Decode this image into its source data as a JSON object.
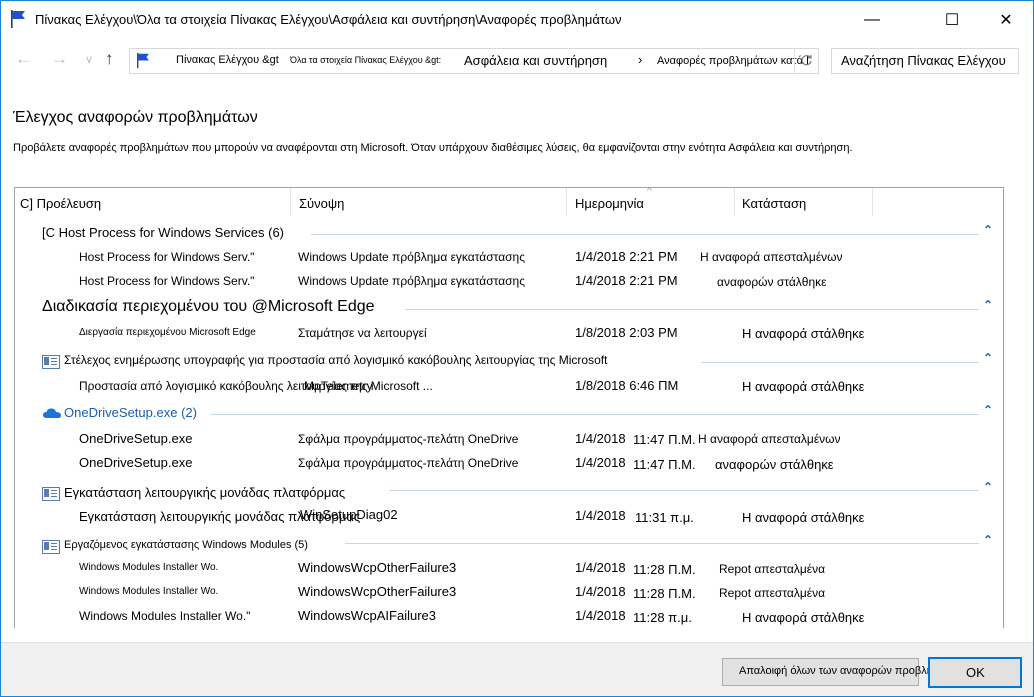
{
  "window": {
    "title": "Πίνακας Ελέγχου\\Όλα τα στοιχεία Πίνακας Ελέγχου\\Ασφάλεια και συντήρηση\\Αναφορές προβλημάτων",
    "minimize_glyph": "—",
    "maximize_glyph": "☐",
    "close_glyph": "✕",
    "icon": "flag-icon",
    "accent_color": "#1883d7"
  },
  "nav": {
    "back_glyph": "←",
    "forward_glyph": "→",
    "recent_glyph": "∨",
    "up_glyph": "↑",
    "breadcrumb": [
      "Πίνακας Ελέγχου &gt",
      "Όλα τα στοιχεία Πίνακας Ελέγχου &gt:",
      "Ασφάλεια και συντήρηση",
      "›",
      "Αναφορές προβλημάτων κατά Ι"
    ],
    "search_placeholder": "Αναζήτηση Πίνακας Ελέγχου"
  },
  "page": {
    "heading": "Έλεγχος αναφορών προβλημάτων",
    "description": "Προβάλετε αναφορές προβλημάτων που μπορούν να αναφέρονται στη Microsoft. Όταν υπάρχουν διαθέσιμες λύσεις, θα εμφανίζονται στην ενότητα Ασφάλεια και συντήρηση."
  },
  "columns": {
    "source": "C] Προέλευση",
    "summary": "Σύνοψη",
    "date": "Ημερομηνία",
    "status": "Κατάσταση",
    "sort_glyph": "^"
  },
  "groups": [
    {
      "title": "[C Host Process for Windows Services (6)",
      "rows": [
        {
          "source": "Host Process for Windows Serv.\"",
          "summary": "Windows Update πρόβλημα εγκατάστασης",
          "date": "1/4/2018 2:21 PM",
          "status": "Η αναφορά απεσταλμένων"
        },
        {
          "source": "Host Process for Windows Serv.\"",
          "summary": "Windows Update πρόβλημα εγκατάστασης",
          "date": "1/4/2018 2:21 PM",
          "status": "αναφορών στάλθηκε"
        }
      ]
    },
    {
      "title": "Διαδικασία περιεχομένου του @Microsoft Edge",
      "rows": [
        {
          "source": "Διεργασία περιεχομένου Microsoft Edge",
          "summary": "Σταμάτησε να λειτουργεί",
          "date": "1/8/2018 2:03 PM",
          "status": "Η αναφορά στάλθηκε"
        }
      ]
    },
    {
      "title": "Στέλεχος ενημέρωσης υπογραφής για προστασία από λογισμικό κακόβουλης λειτουργίας της Microsoft",
      "rows": [
        {
          "source": "Προστασία από λογισμικό κακόβουλης λειτουργίας της Microsoft ...",
          "summary": "MpTelemetry",
          "date": "1/8/2018 6:46 ΠΜ",
          "status": "Η αναφορά στάλθηκε"
        }
      ]
    },
    {
      "title": "OneDriveSetup.exe (2)",
      "rows": [
        {
          "source": "OneDriveSetup.exe",
          "summary": "Σφάλμα προγράμματος-πελάτη OneDrive",
          "date": "1/4/2018",
          "time": "11:47 Π.Μ.",
          "status": "Η αναφορά απεσταλμένων"
        },
        {
          "source": "OneDriveSetup.exe",
          "summary": "Σφάλμα προγράμματος-πελάτη OneDrive",
          "date": "1/4/2018",
          "time": "11:47 Π.Μ.",
          "status": "αναφορών στάλθηκε"
        }
      ]
    },
    {
      "title": "Εγκατάσταση λειτουργικής μονάδας πλατφόρμας",
      "rows": [
        {
          "source": "Εγκατάσταση λειτουργικής μονάδας πλατφόρμας",
          "summary": "WinSetupDiag02",
          "date": "1/4/2018",
          "time": "11:31 π.μ.",
          "status": "Η αναφορά στάλθηκε"
        }
      ]
    },
    {
      "title": "Εργαζόμενος εγκατάστασης Windows Modules (5)",
      "rows": [
        {
          "source": "Windows Modules Installer Wo.",
          "summary": "WindowsWcpOtherFailure3",
          "date": "1/4/2018",
          "time": "11:28 Π.Μ.",
          "status": "Repot απεσταλμένα"
        },
        {
          "source": "Windows Modules Installer Wo.",
          "summary": "WindowsWcpOtherFailure3",
          "date": "1/4/2018",
          "time": "11:28 Π.Μ.",
          "status": "Repot απεσταλμένα"
        },
        {
          "source": "Windows Modules Installer Wo.\"",
          "summary": "WindowsWcpAIFailure3",
          "date": "1/4/2018",
          "time": "11:28 π.μ.",
          "status": "Η αναφορά στάλθηκε"
        }
      ]
    }
  ],
  "collapse_glyph": "⌃",
  "footer": {
    "clear_all_label": "Απαλοιφή όλων των αναφορών προβλημάτων",
    "ok_label": "OK"
  }
}
